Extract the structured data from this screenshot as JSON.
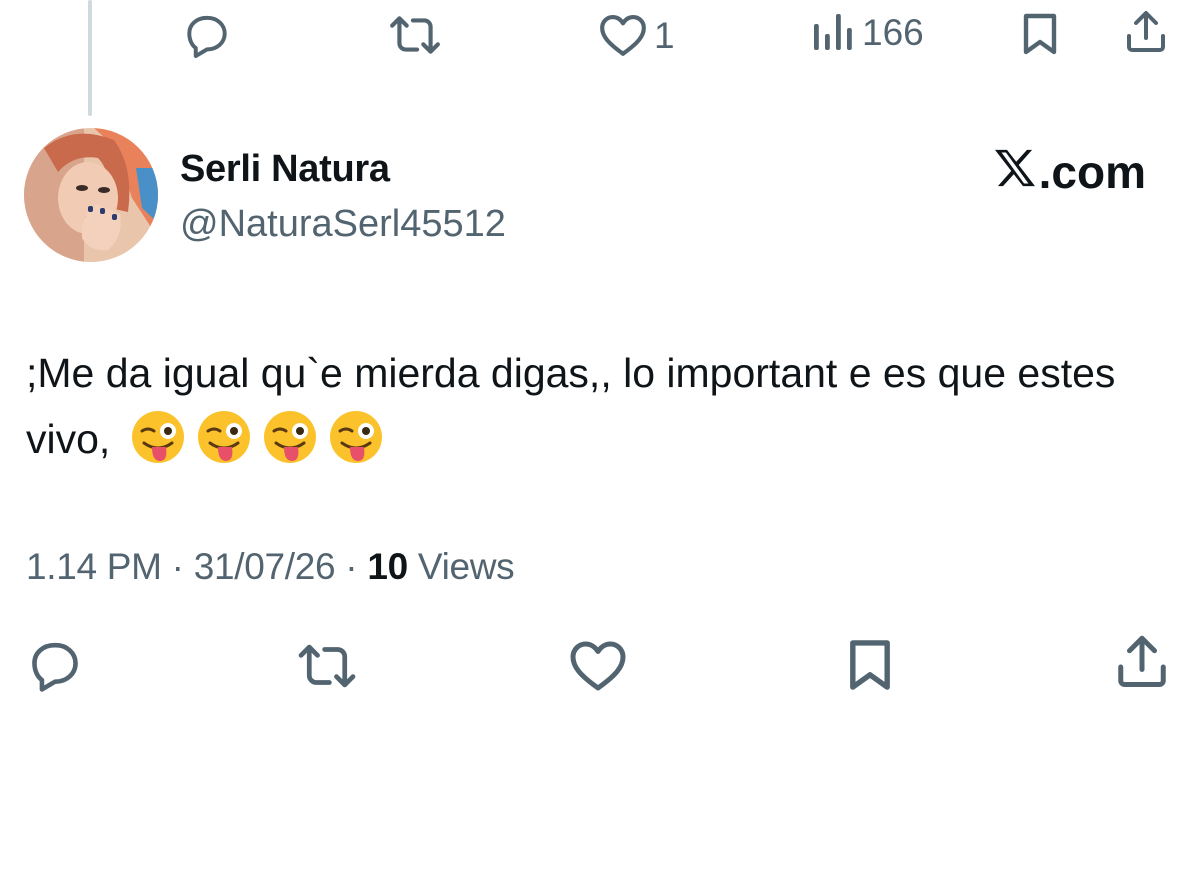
{
  "previous_tweet": {
    "actions": {
      "reply": {
        "icon": "reply-icon",
        "count": ""
      },
      "retweet": {
        "icon": "retweet-icon",
        "count": ""
      },
      "like": {
        "icon": "heart-icon",
        "count": "1"
      },
      "views": {
        "icon": "analytics-icon",
        "count": "166"
      },
      "bookmark": {
        "icon": "bookmark-icon"
      },
      "share": {
        "icon": "share-icon"
      }
    }
  },
  "tweet": {
    "author": {
      "display_name": "Serli Natura",
      "handle": "@NaturaSerl45512"
    },
    "brand": ".com",
    "text": ";Me da igual qu`e mierda digas,, lo important e es que estes vivo,",
    "emoji": [
      "winking-face-with-tongue",
      "winking-face-with-tongue",
      "winking-face-with-tongue",
      "winking-face-with-tongue"
    ],
    "meta": {
      "time": "1.14 PM",
      "separator": " · ",
      "date": "31/07/26",
      "views_count": "10",
      "views_label": " Views"
    },
    "actions": [
      "reply-icon",
      "retweet-icon",
      "heart-icon",
      "bookmark-icon",
      "share-icon"
    ]
  },
  "colors": {
    "text_primary": "#0f1419",
    "text_secondary": "#536471",
    "thread_line": "#cfd9de"
  }
}
